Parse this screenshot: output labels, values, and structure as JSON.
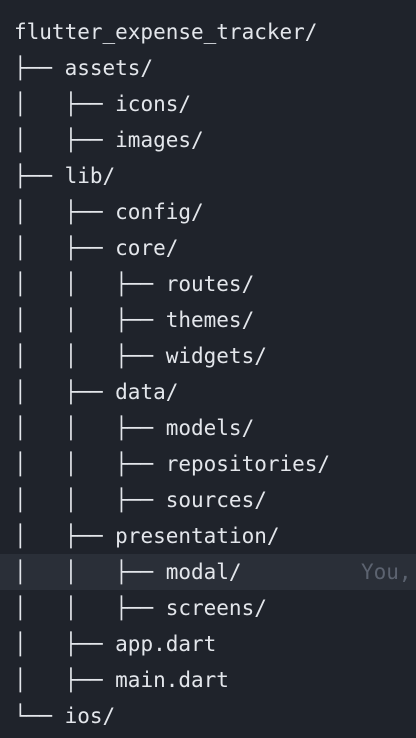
{
  "tree": {
    "lines": [
      {
        "prefix": "",
        "name": "flutter_expense_tracker/"
      },
      {
        "prefix": "├── ",
        "name": "assets/"
      },
      {
        "prefix": "│   ├── ",
        "name": "icons/"
      },
      {
        "prefix": "│   ├── ",
        "name": "images/"
      },
      {
        "prefix": "├── ",
        "name": "lib/"
      },
      {
        "prefix": "│   ├── ",
        "name": "config/"
      },
      {
        "prefix": "│   ├── ",
        "name": "core/"
      },
      {
        "prefix": "│   │   ├── ",
        "name": "routes/"
      },
      {
        "prefix": "│   │   ├── ",
        "name": "themes/"
      },
      {
        "prefix": "│   │   ├── ",
        "name": "widgets/"
      },
      {
        "prefix": "│   ├── ",
        "name": "data/"
      },
      {
        "prefix": "│   │   ├── ",
        "name": "models/"
      },
      {
        "prefix": "│   │   ├── ",
        "name": "repositories/"
      },
      {
        "prefix": "│   │   ├── ",
        "name": "sources/"
      },
      {
        "prefix": "│   ├── ",
        "name": "presentation/"
      },
      {
        "prefix": "│   │   ├── ",
        "name": "modal/"
      },
      {
        "prefix": "│   │   ├── ",
        "name": "screens/"
      },
      {
        "prefix": "│   ├── ",
        "name": "app.dart"
      },
      {
        "prefix": "│   ├── ",
        "name": "main.dart"
      },
      {
        "prefix": "└── ",
        "name": "ios/"
      }
    ],
    "blame_text": "You,"
  },
  "colors": {
    "background": "#1f232b",
    "highlight": "#2a2f38",
    "text": "#e3e6eb",
    "blame": "#5c6370"
  }
}
